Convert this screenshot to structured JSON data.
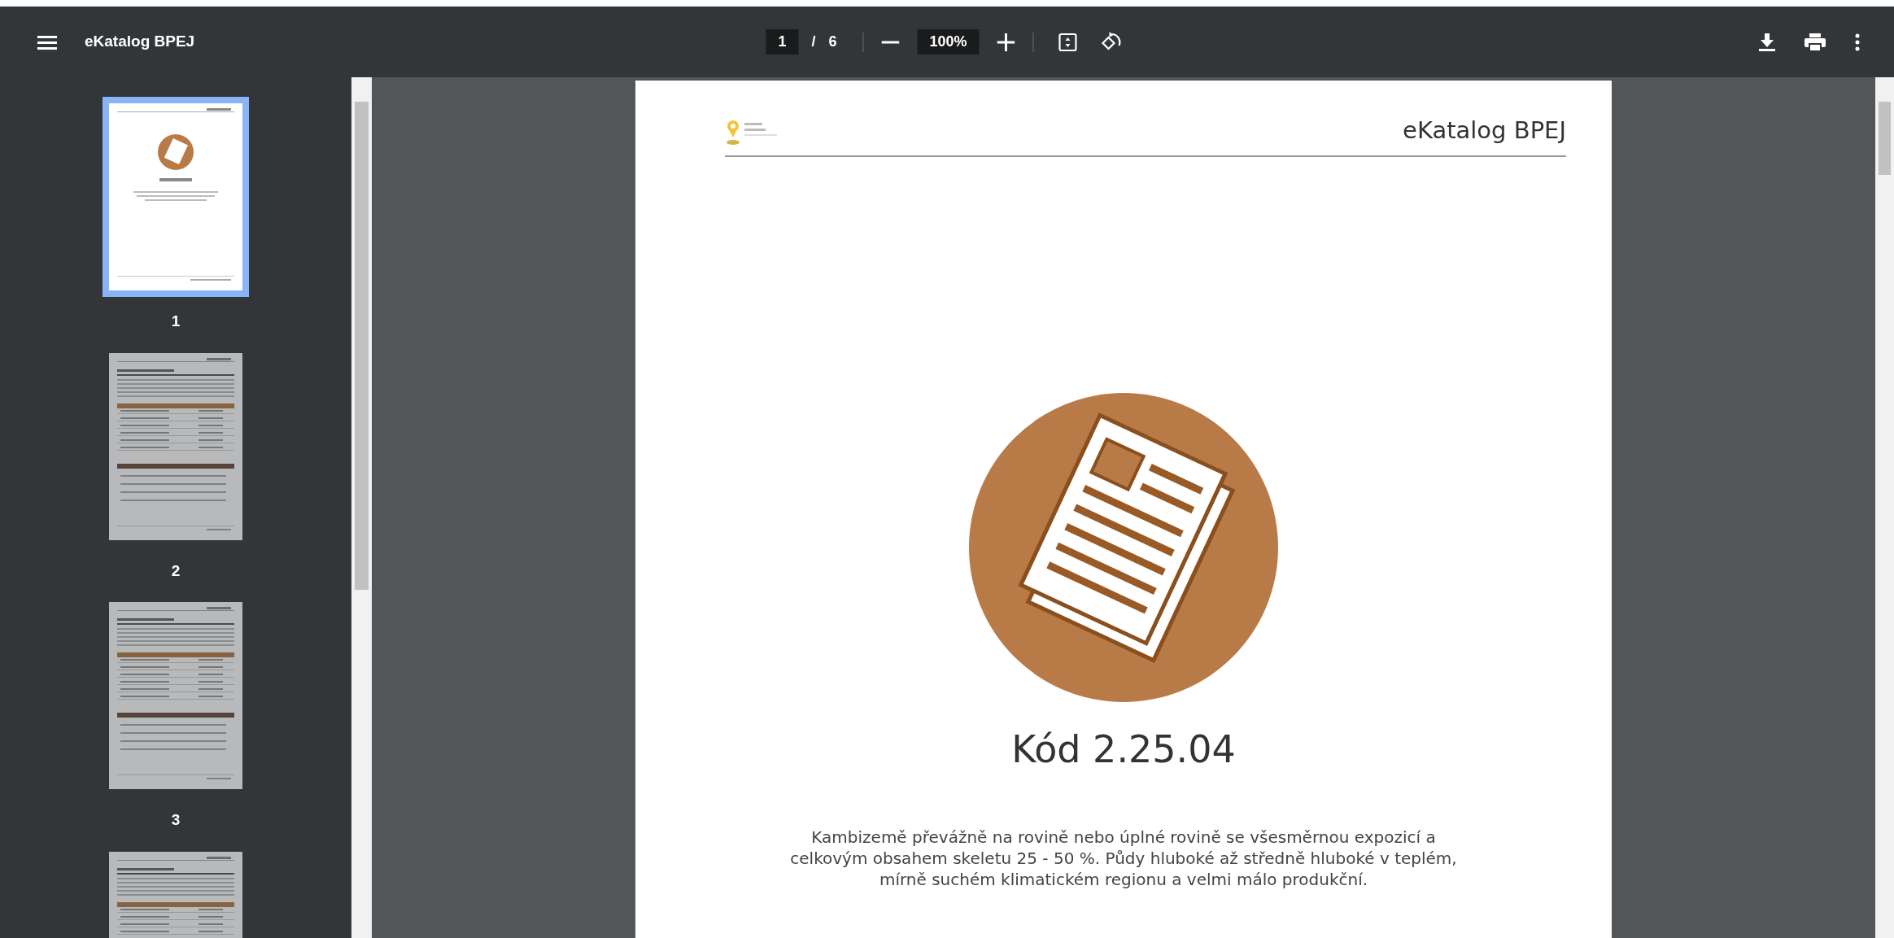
{
  "toolbar": {
    "title": "eKatalog BPEJ",
    "page_current": "1",
    "page_separator": "/",
    "page_total": "6",
    "zoom": "100%"
  },
  "thumbnails": [
    {
      "label": "1",
      "selected": true,
      "kind": "cover"
    },
    {
      "label": "2",
      "selected": false,
      "kind": "table"
    },
    {
      "label": "3",
      "selected": false,
      "kind": "table"
    },
    {
      "selected": false,
      "kind": "table"
    }
  ],
  "document_page": {
    "header_title": "eKatalog BPEJ",
    "code": "Kód 2.25.04",
    "description": "Kambizemě převážně na rovině nebo úplné rovině se všesměrnou expozicí a celkovým obsahem skeletu 25 - 50 %. Půdy hluboké až středně hluboké v teplém, mírně suchém klimatickém regionu a velmi málo produkční."
  }
}
